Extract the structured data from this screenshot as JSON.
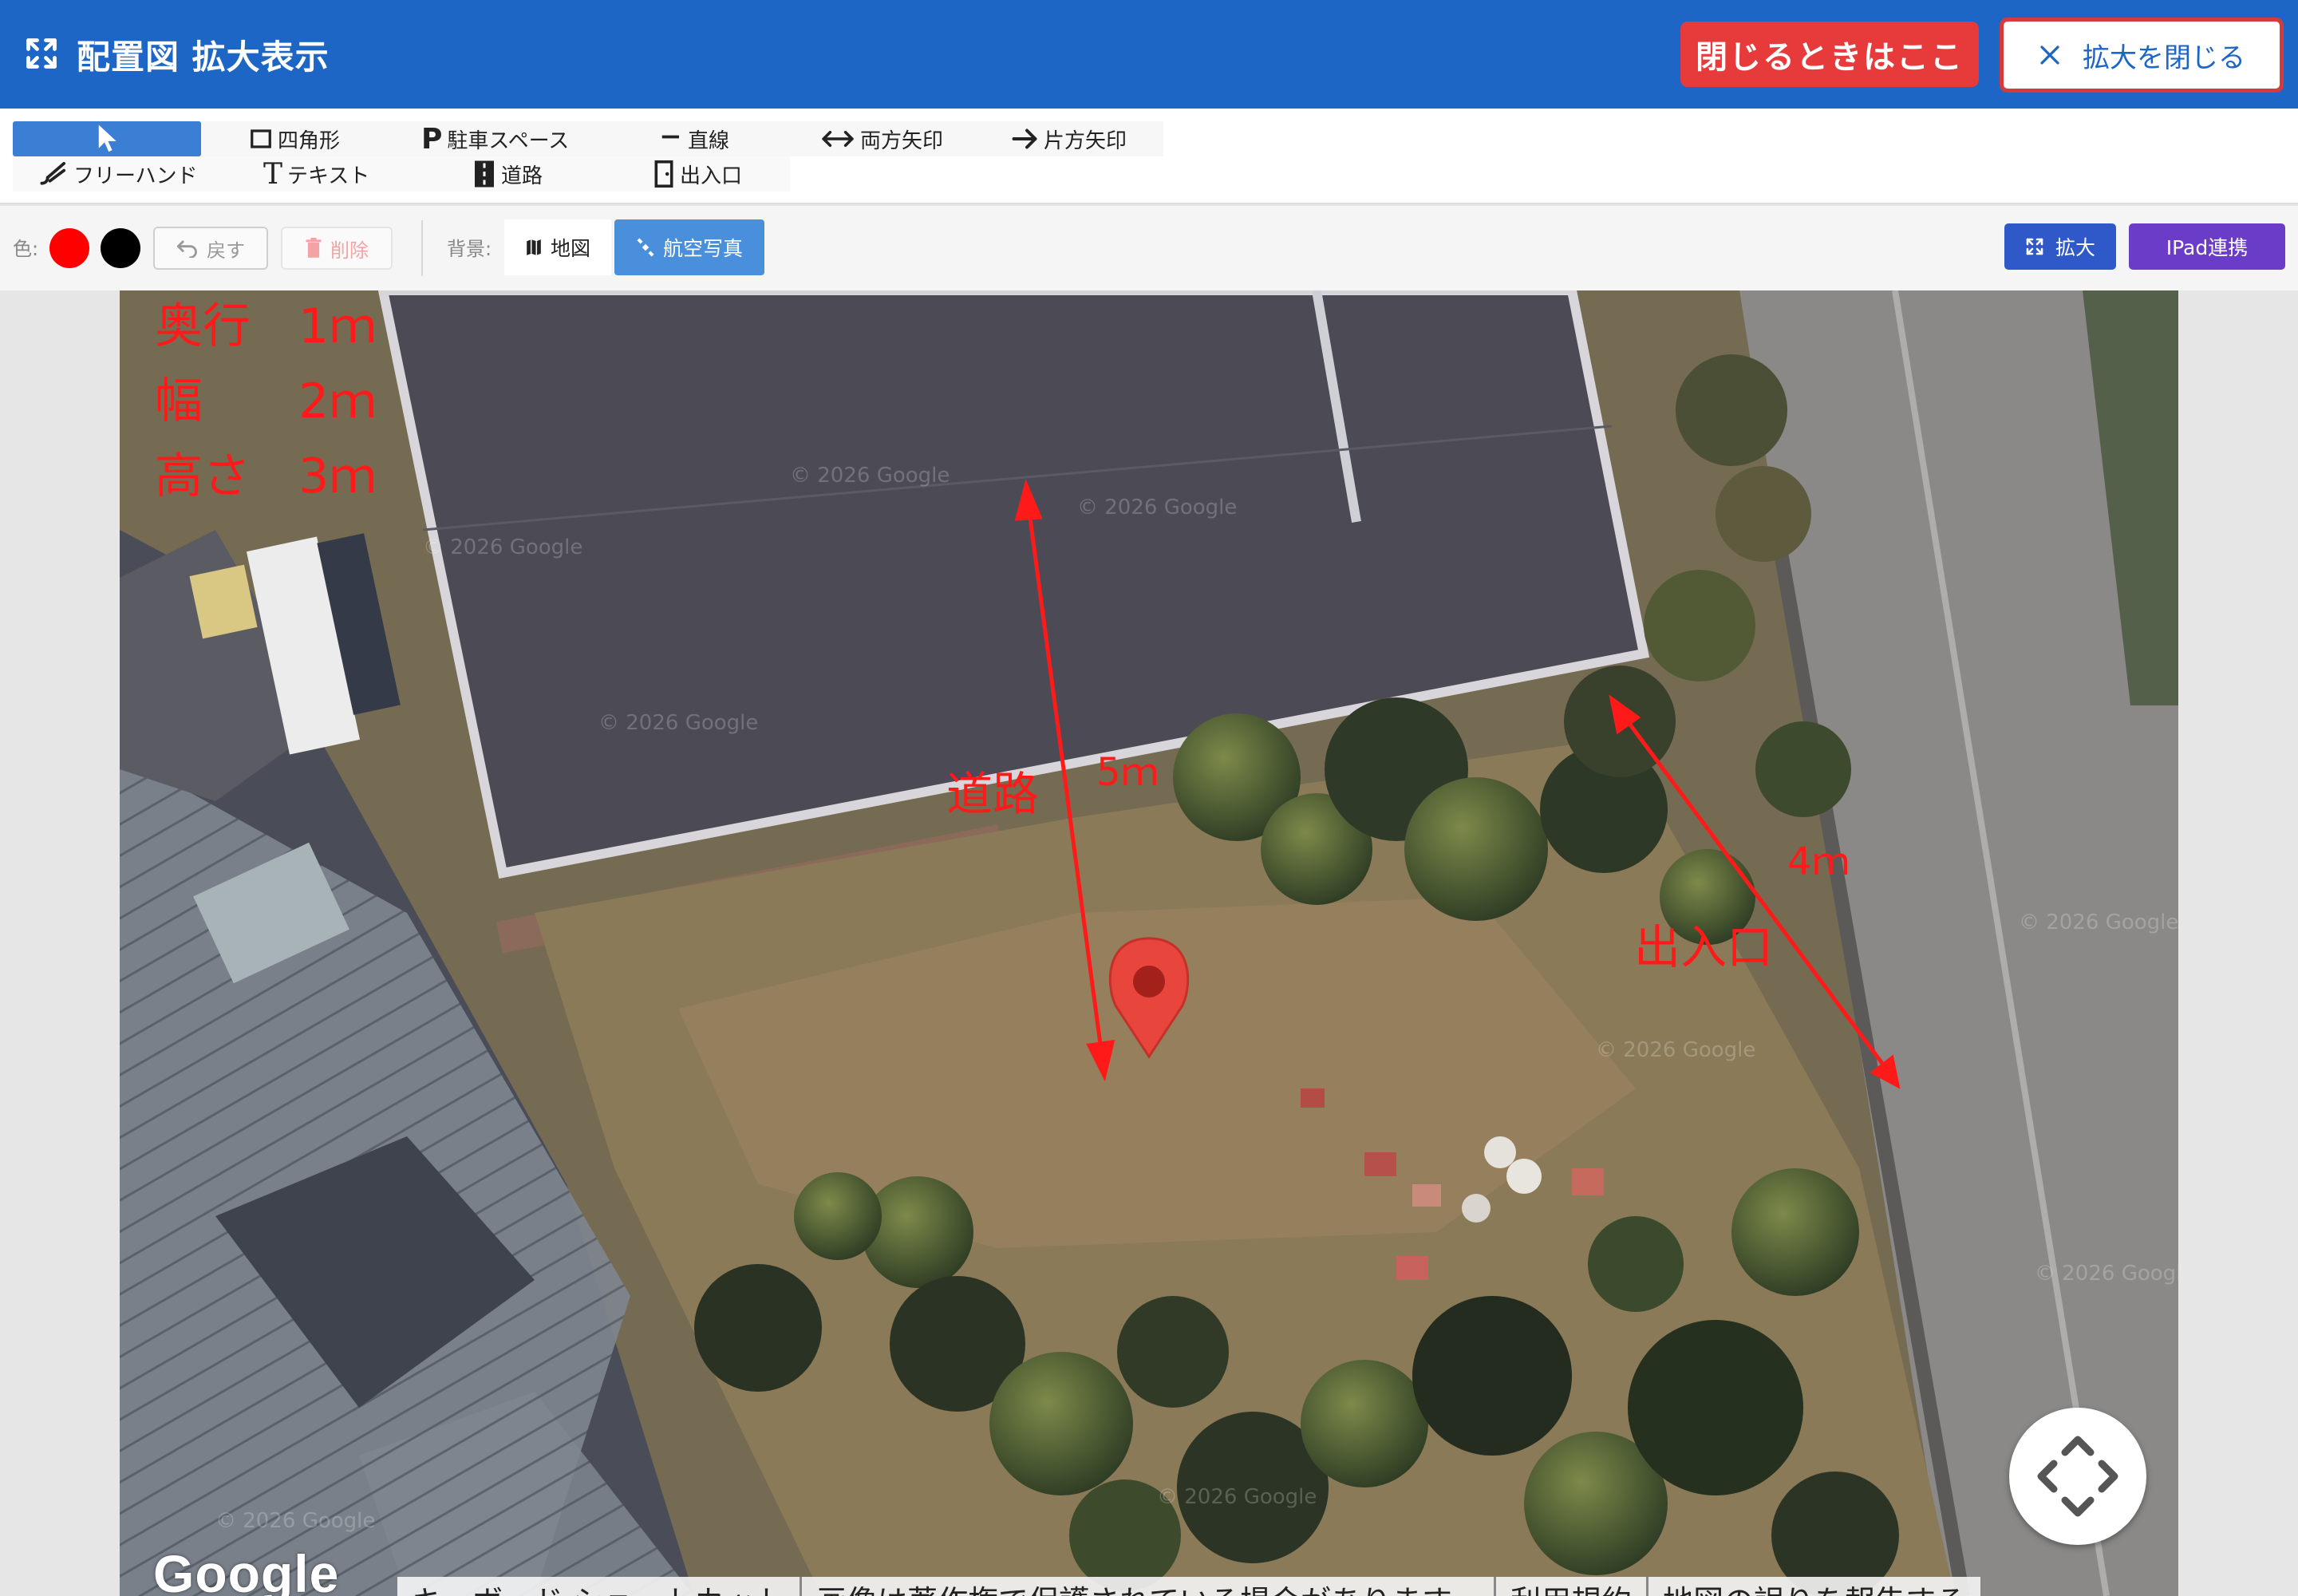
{
  "header": {
    "title": "配置図 拡大表示",
    "close_here_label": "閉じるときはここ",
    "close_zoom_label": "拡大を閉じる",
    "background_color": "#1d66c6"
  },
  "toolbar": {
    "tools": [
      {
        "id": "select",
        "label": "",
        "icon": "cursor-icon"
      },
      {
        "id": "rectangle",
        "label": "四角形",
        "icon": "square-icon"
      },
      {
        "id": "parking",
        "label": "駐車スペース",
        "icon": "parking-icon"
      },
      {
        "id": "line",
        "label": "直線",
        "icon": "line-icon"
      },
      {
        "id": "double_arrow",
        "label": "両方矢印",
        "icon": "double-arrow-icon"
      },
      {
        "id": "single_arrow",
        "label": "片方矢印",
        "icon": "arrow-right-icon"
      },
      {
        "id": "freehand",
        "label": "フリーハンド",
        "icon": "brush-icon"
      },
      {
        "id": "text",
        "label": "テキスト",
        "icon": "text-icon"
      },
      {
        "id": "road",
        "label": "道路",
        "icon": "road-icon"
      },
      {
        "id": "entrance",
        "label": "出入口",
        "icon": "door-icon"
      }
    ],
    "active_tool": "select",
    "active_color": "#3a7fd4"
  },
  "options": {
    "color_label": "色:",
    "colors": [
      "#ff0000",
      "#000000"
    ],
    "undo_label": "戻す",
    "delete_label": "削除",
    "background_label": "背景:",
    "bg_map_label": "地図",
    "bg_aerial_label": "航空写真",
    "bg_selected": "航空写真",
    "zoom_label": "拡大",
    "ipad_label": "IPad連携"
  },
  "map": {
    "dimensions": {
      "depth": "奥行　1ｍ",
      "width": "幅　　2ｍ",
      "height": "高さ　3ｍ"
    },
    "annotations": {
      "road": "道路",
      "road_length": "5ｍ",
      "entrance": "出入口",
      "entrance_length": "4ｍ"
    },
    "google_logo": "Google",
    "footer_links": [
      "キーボード ショートカット",
      "画像は著作権で保護されている場合があります。",
      "利用規約",
      "地図の誤りを報告する"
    ],
    "watermark": "© 2026 Google",
    "annotation_color": "#ff1a1a"
  }
}
